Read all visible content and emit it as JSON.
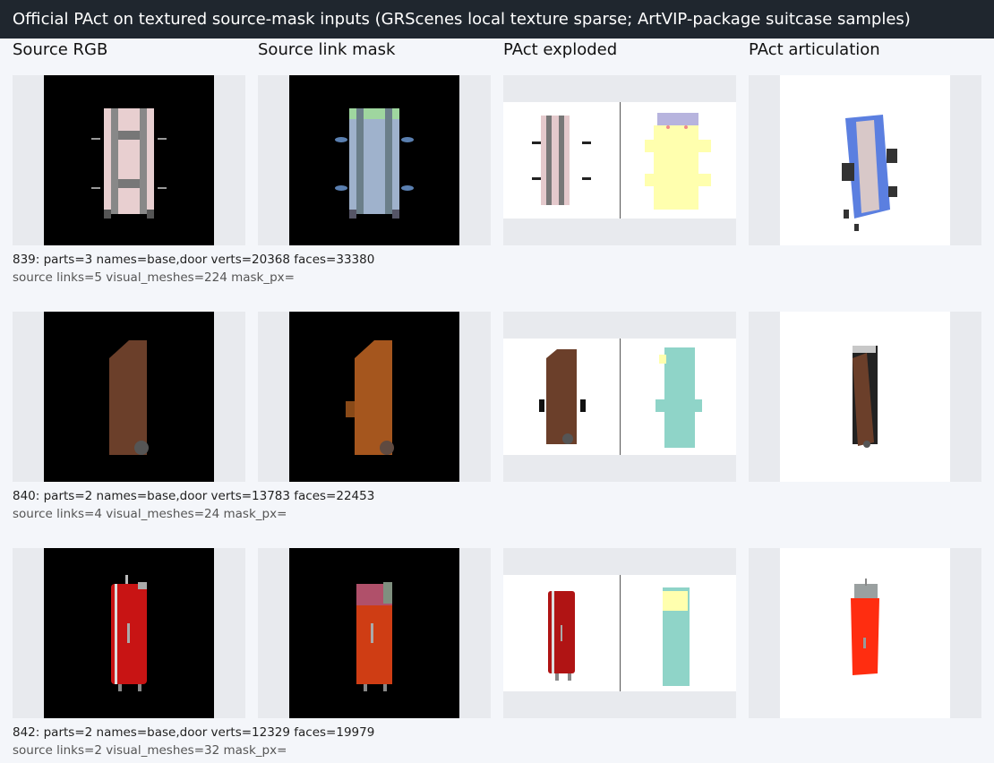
{
  "title": "Official PAct on textured source-mask inputs (GRScenes local texture sparse; ArtVIP-package suitcase samples)",
  "columns": [
    "Source RGB",
    "Source link mask",
    "PAct exploded",
    "PAct articulation"
  ],
  "rows": [
    {
      "line1": "839: parts=3 names=base,door verts=20368 faces=33380",
      "line2": "source links=5 visual_meshes=224 mask_px="
    },
    {
      "line1": "840: parts=2 names=base,door verts=13783 faces=22453",
      "line2": "source links=4 visual_meshes=24 mask_px="
    },
    {
      "line1": "842: parts=2 names=base,door verts=12329 faces=19979",
      "line2": "source links=2 visual_meshes=32 mask_px="
    }
  ]
}
